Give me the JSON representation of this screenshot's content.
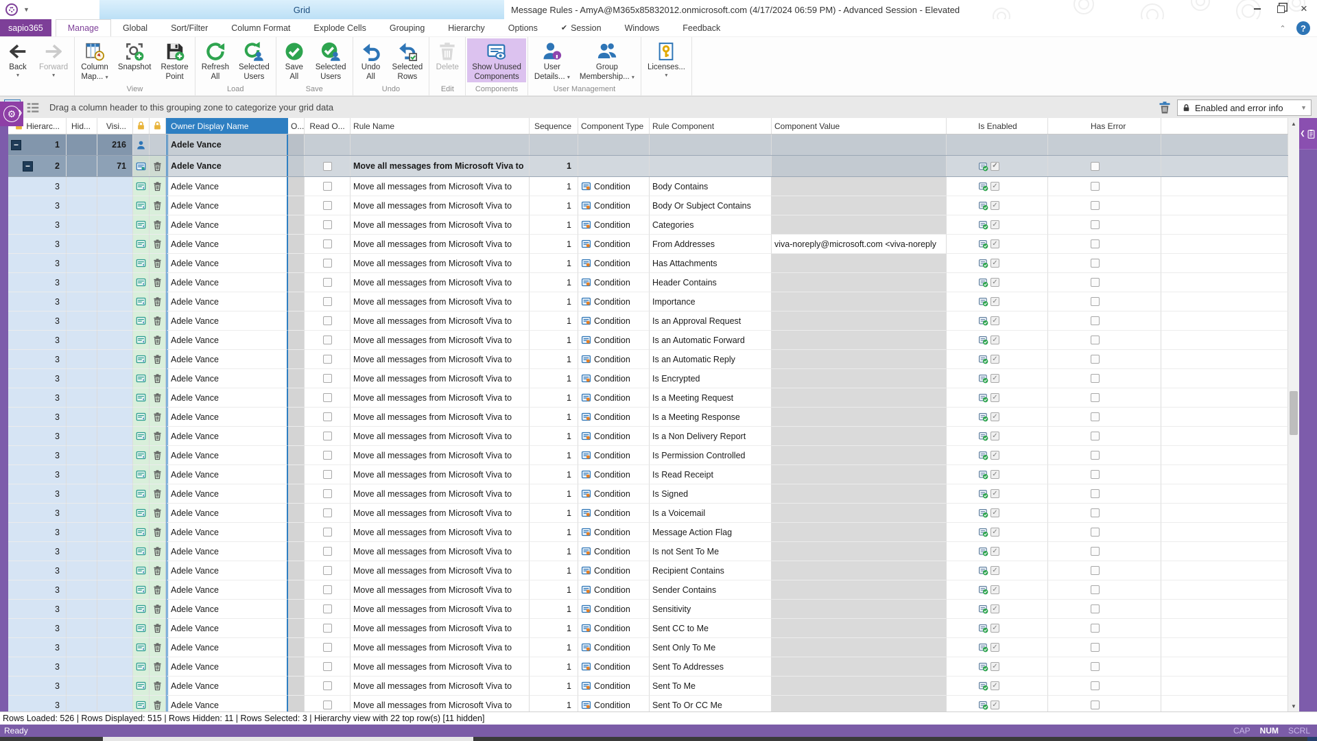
{
  "titlebar": {
    "contextual_tab": "Grid",
    "title": "Message Rules - AmyA@M365x85832012.onmicrosoft.com (4/17/2024 06:59 PM) - Advanced Session - Elevated"
  },
  "tabs": {
    "app_tab": "sapio365",
    "items": [
      {
        "label": "Manage",
        "active": true
      },
      {
        "label": "Global"
      },
      {
        "label": "Sort/Filter"
      },
      {
        "label": "Column Format"
      },
      {
        "label": "Explode Cells"
      },
      {
        "label": "Grouping"
      },
      {
        "label": "Hierarchy"
      },
      {
        "label": "Options"
      },
      {
        "label": "Session",
        "check": true
      },
      {
        "label": "Windows"
      },
      {
        "label": "Feedback"
      }
    ]
  },
  "ribbon": {
    "groups": [
      {
        "label": "",
        "buttons": [
          {
            "lines": [
              "Back"
            ],
            "icon": "back",
            "caret": true
          },
          {
            "lines": [
              "Forward"
            ],
            "icon": "forward",
            "caret": true,
            "disabled": true
          }
        ]
      },
      {
        "label": "View",
        "buttons": [
          {
            "lines": [
              "Column",
              "Map..."
            ],
            "icon": "column-map",
            "caret": true
          },
          {
            "lines": [
              "Snapshot"
            ],
            "icon": "snapshot"
          },
          {
            "lines": [
              "Restore",
              "Point"
            ],
            "icon": "restore-point"
          }
        ]
      },
      {
        "label": "Load",
        "buttons": [
          {
            "lines": [
              "Refresh",
              "All"
            ],
            "icon": "refresh"
          },
          {
            "lines": [
              "Selected",
              "Users"
            ],
            "icon": "refresh-user"
          }
        ]
      },
      {
        "label": "Save",
        "buttons": [
          {
            "lines": [
              "Save",
              "All"
            ],
            "icon": "save"
          },
          {
            "lines": [
              "Selected",
              "Users"
            ],
            "icon": "save-user"
          }
        ]
      },
      {
        "label": "Undo",
        "buttons": [
          {
            "lines": [
              "Undo",
              "All"
            ],
            "icon": "undo"
          },
          {
            "lines": [
              "Selected",
              "Rows"
            ],
            "icon": "undo-rows"
          }
        ]
      },
      {
        "label": "Edit",
        "buttons": [
          {
            "lines": [
              "Delete"
            ],
            "icon": "delete",
            "disabled": true
          }
        ]
      },
      {
        "label": "Components",
        "buttons": [
          {
            "lines": [
              "Show Unused",
              "Components"
            ],
            "icon": "show-unused",
            "active": true
          }
        ]
      },
      {
        "label": "User Management",
        "buttons": [
          {
            "lines": [
              "User",
              "Details..."
            ],
            "icon": "user-details",
            "caret": true
          },
          {
            "lines": [
              "Group",
              "Membership..."
            ],
            "icon": "group-membership",
            "caret": true
          }
        ]
      },
      {
        "label": "",
        "buttons": [
          {
            "lines": [
              "Licenses..."
            ],
            "icon": "licenses",
            "caret": true
          }
        ]
      }
    ]
  },
  "grouping_bar": {
    "hint": "Drag a column header to this grouping zone to categorize your grid data",
    "filter_label": "Enabled and error info"
  },
  "grid": {
    "columns": [
      {
        "key": "hier",
        "label": "Hierarc...",
        "lock": true
      },
      {
        "key": "hid",
        "label": "Hid..."
      },
      {
        "key": "visi",
        "label": "Visi..."
      },
      {
        "key": "icon1",
        "label": "",
        "lock": true
      },
      {
        "key": "icon2",
        "label": "",
        "lock": true
      },
      {
        "key": "owner",
        "label": "Owner Display Name",
        "selected": true
      },
      {
        "key": "o",
        "label": "O..."
      },
      {
        "key": "reado",
        "label": "Read O..."
      },
      {
        "key": "rule",
        "label": "Rule Name"
      },
      {
        "key": "seq",
        "label": "Sequence"
      },
      {
        "key": "ctype",
        "label": "Component Type"
      },
      {
        "key": "rcomp",
        "label": "Rule Component"
      },
      {
        "key": "cval",
        "label": "Component Value"
      },
      {
        "key": "enabled",
        "label": "Is Enabled"
      },
      {
        "key": "error",
        "label": "Has Error"
      },
      {
        "key": "pad",
        "label": ""
      }
    ],
    "group_rows": [
      {
        "hier": "1",
        "visi": "216",
        "owner": "Adele Vance",
        "icon": "person"
      },
      {
        "hier": "2",
        "visi": "71",
        "owner": "Adele Vance",
        "icon": "folder",
        "trash": true,
        "rule_name": "Move all messages from Microsoft Viva to",
        "sequence": "1"
      }
    ],
    "detail_defaults": {
      "hier": "3",
      "owner": "Adele Vance",
      "rule_name": "Move all messages from Microsoft Viva to",
      "sequence": "1",
      "component_type": "Condition"
    },
    "detail_rows": [
      {
        "component": "Body Contains"
      },
      {
        "component": "Body Or Subject Contains"
      },
      {
        "component": "Categories"
      },
      {
        "component": "From Addresses",
        "value": "viva-noreply@microsoft.com <viva-noreply"
      },
      {
        "component": "Has Attachments"
      },
      {
        "component": "Header Contains"
      },
      {
        "component": "Importance"
      },
      {
        "component": "Is an Approval Request"
      },
      {
        "component": "Is an Automatic Forward"
      },
      {
        "component": "Is an Automatic Reply"
      },
      {
        "component": "Is Encrypted"
      },
      {
        "component": "Is a Meeting Request"
      },
      {
        "component": "Is a Meeting Response"
      },
      {
        "component": "Is a Non Delivery Report"
      },
      {
        "component": "Is Permission Controlled"
      },
      {
        "component": "Is Read Receipt"
      },
      {
        "component": "Is Signed"
      },
      {
        "component": "Is a Voicemail"
      },
      {
        "component": "Message Action Flag"
      },
      {
        "component": "Is not Sent To Me"
      },
      {
        "component": "Recipient Contains"
      },
      {
        "component": "Sender Contains"
      },
      {
        "component": "Sensitivity"
      },
      {
        "component": "Sent CC to Me"
      },
      {
        "component": "Sent Only To Me"
      },
      {
        "component": "Sent To Addresses"
      },
      {
        "component": "Sent To Me"
      },
      {
        "component": "Sent To Or CC Me"
      }
    ]
  },
  "status": {
    "rows_info": "Rows Loaded: 526 | Rows Displayed: 515 | Rows Hidden: 11 | Rows Selected: 3 | Hierarchy view with 22 top row(s) [11 hidden]",
    "ready": "Ready",
    "keys": [
      {
        "label": "CAP",
        "on": false
      },
      {
        "label": "NUM",
        "on": true
      },
      {
        "label": "SCRL",
        "on": false
      }
    ]
  },
  "colors": {
    "brand_purple": "#7d3f98",
    "rail_purple": "#7d5cab",
    "selected_header_blue": "#2e7fc2",
    "contextual_tab_blue": "#c3e4f7",
    "green": "#2ea44f",
    "icon_blue": "#2e75b6"
  }
}
